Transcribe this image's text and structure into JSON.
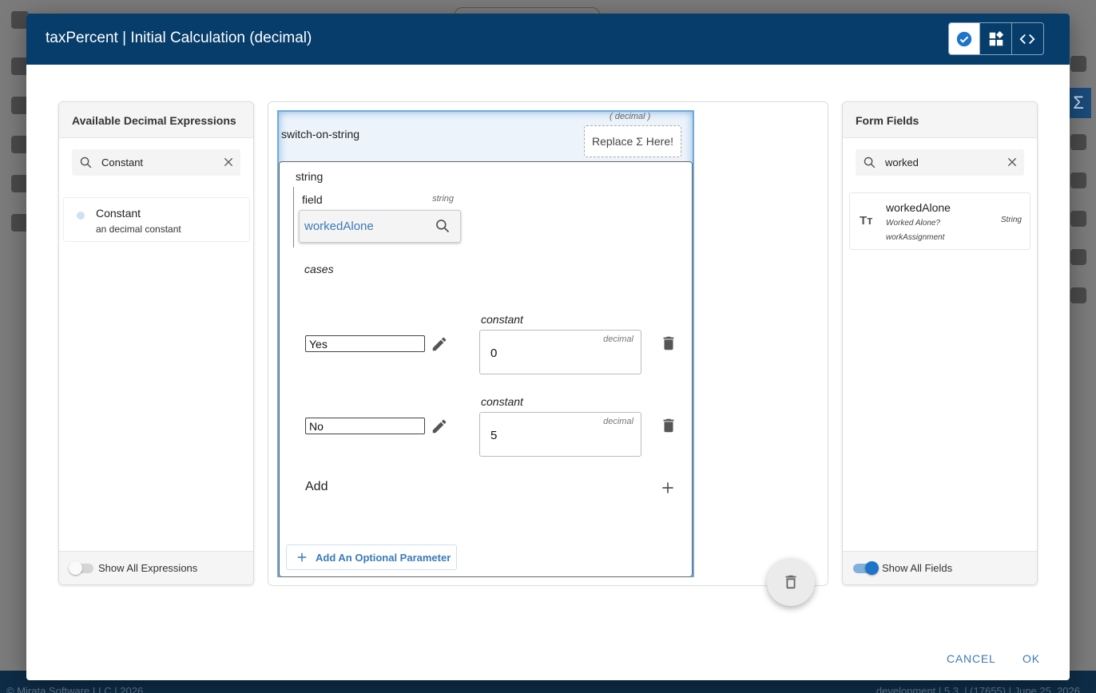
{
  "background": {
    "footer_left": "© Mirata Software LLC | 2026",
    "footer_right": "development | 5.3. | (17655) | June 25, 2026"
  },
  "dialog": {
    "title": "taxPercent | Initial Calculation (decimal)",
    "header_buttons": [
      "check-circle-icon",
      "widgets-icon",
      "code-icon"
    ]
  },
  "left_panel": {
    "title": "Available Decimal Expressions",
    "search_value": "Constant",
    "items": [
      {
        "name": "Constant",
        "description": "an decimal constant"
      }
    ],
    "toggle_label": "Show All Expressions",
    "toggle_on": false
  },
  "canvas": {
    "switch_label": "switch-on-string",
    "type_hint": "( decimal )",
    "replace_label": "Replace Σ Here!",
    "string_label": "string",
    "field_label": "field",
    "field_type": "string",
    "field_value": "workedAlone",
    "cases_label": "cases",
    "cases": [
      {
        "key": "Yes",
        "const_label": "constant",
        "const_type": "decimal",
        "value": "0"
      },
      {
        "key": "No",
        "const_label": "constant",
        "const_type": "decimal",
        "value": "5"
      }
    ],
    "add_label": "Add",
    "optional_param_label": "Add An Optional Parameter"
  },
  "right_panel": {
    "title": "Form Fields",
    "search_value": "worked",
    "items": [
      {
        "name": "workedAlone",
        "label": "Worked Alone?",
        "group": "workAssignment",
        "type": "String"
      }
    ],
    "toggle_label": "Show All Fields",
    "toggle_on": true
  },
  "actions": {
    "cancel": "CANCEL",
    "ok": "OK"
  },
  "colors": {
    "header": "#063d6b",
    "accent": "#3b7ab9",
    "toggle_on": "#1e74c9"
  }
}
